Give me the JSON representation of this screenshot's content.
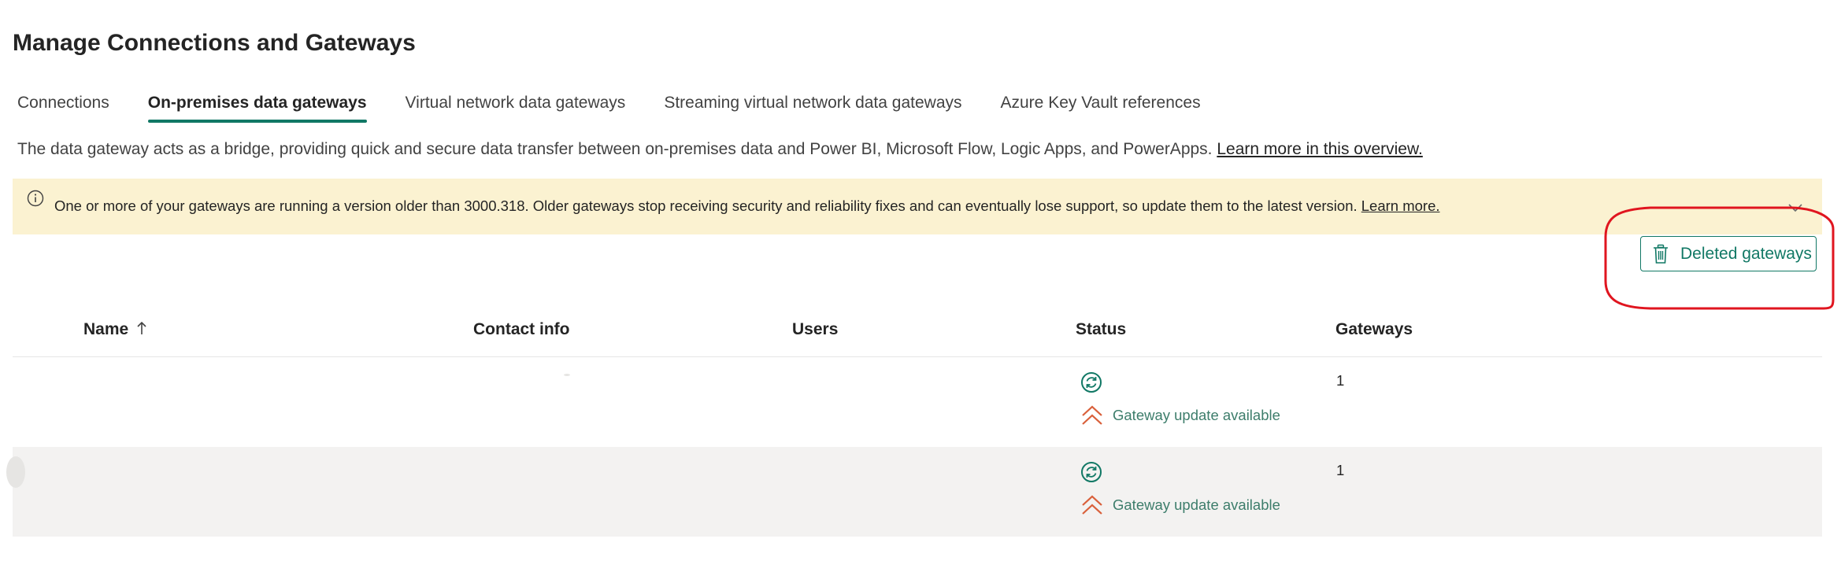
{
  "page": {
    "title": "Manage Connections and Gateways"
  },
  "tabs": [
    {
      "label": "Connections",
      "active": false
    },
    {
      "label": "On-premises data gateways",
      "active": true
    },
    {
      "label": "Virtual network data gateways",
      "active": false
    },
    {
      "label": "Streaming virtual network data gateways",
      "active": false
    },
    {
      "label": "Azure Key Vault references",
      "active": false
    }
  ],
  "description": {
    "text": "The data gateway acts as a bridge, providing quick and secure data transfer between on-premises data and Power BI, Microsoft Flow, Logic Apps, and PowerApps.",
    "link": "Learn more in this overview."
  },
  "banner": {
    "icon": "info-icon",
    "text": "One or more of your gateways are running a version older than 3000.318. Older gateways stop receiving security and reliability fixes and can eventually lose support, so update them to the latest version.",
    "link": "Learn more.",
    "background": "#fbf2d1"
  },
  "toolbar": {
    "deleted_gateways_label": "Deleted gateways",
    "deleted_gateways_icon": "trash-icon"
  },
  "table": {
    "columns": [
      {
        "key": "name",
        "label": "Name",
        "sort_icon": "arrow-up-icon"
      },
      {
        "key": "contact",
        "label": "Contact info"
      },
      {
        "key": "users",
        "label": "Users"
      },
      {
        "key": "status",
        "label": "Status"
      },
      {
        "key": "gateways",
        "label": "Gateways"
      }
    ],
    "rows": [
      {
        "name": "",
        "contact": "",
        "users": "",
        "status_icon": "refresh-icon",
        "status_text": "Gateway update available",
        "status_text_icon": "double-chevron-up-icon",
        "gateways": "1"
      },
      {
        "name": "",
        "contact": "",
        "users": "",
        "status_icon": "refresh-icon",
        "status_text": "Gateway update available",
        "status_text_icon": "double-chevron-up-icon",
        "gateways": "1"
      }
    ]
  },
  "colors": {
    "accent": "#117865",
    "status_text": "#3d7d6b",
    "update_icon": "#d9603b",
    "highlight": "#e0151f"
  }
}
